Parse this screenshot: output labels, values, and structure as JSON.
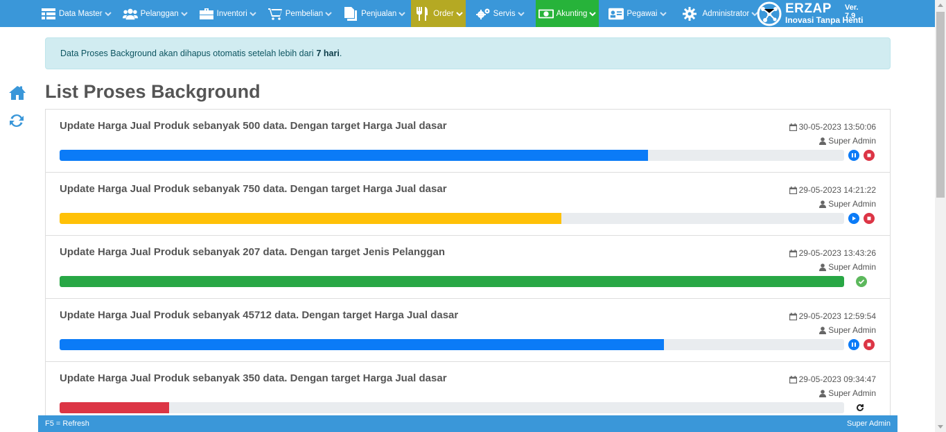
{
  "nav": {
    "items": [
      {
        "label": "Data Master",
        "icon": "table-icon"
      },
      {
        "label": "Pelanggan",
        "icon": "users-icon"
      },
      {
        "label": "Inventori",
        "icon": "briefcase-icon"
      },
      {
        "label": "Pembelian",
        "icon": "cart-icon"
      },
      {
        "label": "Penjualan",
        "icon": "document-icon"
      },
      {
        "label": "Order",
        "icon": "cutlery-icon"
      },
      {
        "label": "Servis",
        "icon": "gears-icon"
      },
      {
        "label": "Akunting",
        "icon": "money-icon"
      },
      {
        "label": "Pegawai",
        "icon": "id-card-icon"
      },
      {
        "label": "Administrator",
        "icon": "gear-icon"
      }
    ],
    "highlight": {
      "order": "#b5a923",
      "akunting": "#27b33a"
    }
  },
  "brand": {
    "name": "ERZAP",
    "tagline": "Inovasi Tanpa Henti",
    "version": "Ver. 7.9"
  },
  "alert": {
    "text": "Data Proses Background akan dihapus otomatis setelah lebih dari",
    "bold": "7 hari",
    "suffix": "."
  },
  "page_title": "List Proses Background",
  "jobs": [
    {
      "title": "Update Harga Jual Produk sebanyak 500 data. Dengan target Harga Jual dasar",
      "datetime": "30-05-2023 13:50:06",
      "user": "Super Admin",
      "progress": 0.75,
      "color": "#0b7bf7",
      "actions": [
        "pause",
        "stop"
      ]
    },
    {
      "title": "Update Harga Jual Produk sebanyak 750 data. Dengan target Harga Jual dasar",
      "datetime": "29-05-2023 14:21:22",
      "user": "Super Admin",
      "progress": 0.64,
      "color": "#ffc107",
      "actions": [
        "play",
        "stop"
      ]
    },
    {
      "title": "Update Harga Jual Produk sebanyak 207 data. Dengan target Jenis Pelanggan",
      "datetime": "29-05-2023 13:43:26",
      "user": "Super Admin",
      "progress": 1.0,
      "color": "#28a745",
      "actions": [
        "done"
      ]
    },
    {
      "title": "Update Harga Jual Produk sebanyak 45712 data. Dengan target Harga Jual dasar",
      "datetime": "29-05-2023 12:59:54",
      "user": "Super Admin",
      "progress": 0.77,
      "color": "#0b7bf7",
      "actions": [
        "pause",
        "stop"
      ]
    },
    {
      "title": "Update Harga Jual Produk sebanyak 350 data. Dengan target Harga Jual dasar",
      "datetime": "29-05-2023 09:34:47",
      "user": "Super Admin",
      "progress": 0.14,
      "color": "#dc3545",
      "actions": [
        "retry"
      ]
    }
  ],
  "footer": {
    "left": "F5 = Refresh",
    "right": "Super Admin"
  }
}
